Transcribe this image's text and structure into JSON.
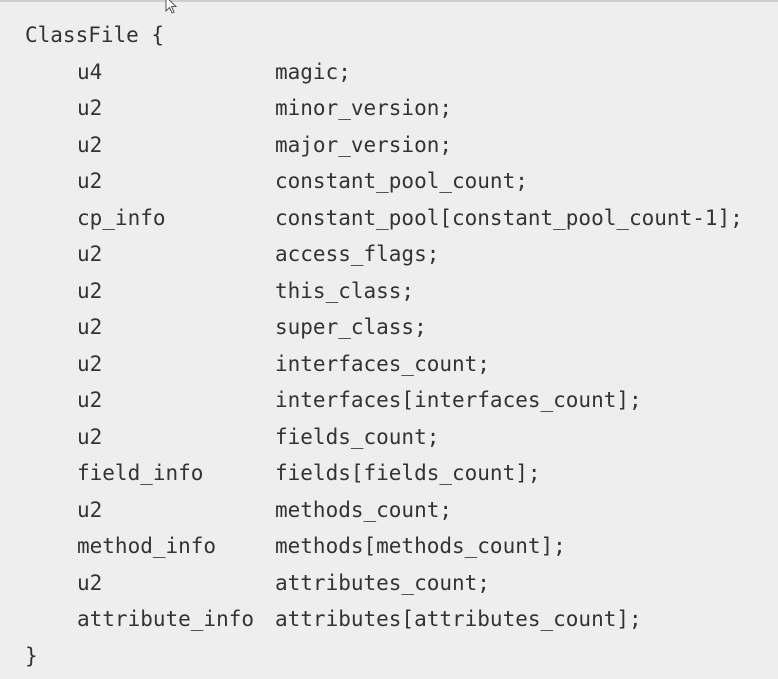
{
  "code": {
    "opening_line": "ClassFile {",
    "closing_line": "}",
    "fields": [
      {
        "type": "u4",
        "name": "magic;"
      },
      {
        "type": "u2",
        "name": "minor_version;"
      },
      {
        "type": "u2",
        "name": "major_version;"
      },
      {
        "type": "u2",
        "name": "constant_pool_count;"
      },
      {
        "type": "cp_info",
        "name": "constant_pool[constant_pool_count-1];"
      },
      {
        "type": "u2",
        "name": "access_flags;"
      },
      {
        "type": "u2",
        "name": "this_class;"
      },
      {
        "type": "u2",
        "name": "super_class;"
      },
      {
        "type": "u2",
        "name": "interfaces_count;"
      },
      {
        "type": "u2",
        "name": "interfaces[interfaces_count];"
      },
      {
        "type": "u2",
        "name": "fields_count;"
      },
      {
        "type": "field_info",
        "name": "fields[fields_count];"
      },
      {
        "type": "u2",
        "name": "methods_count;"
      },
      {
        "type": "method_info",
        "name": "methods[methods_count];"
      },
      {
        "type": "u2",
        "name": "attributes_count;"
      },
      {
        "type": "attribute_info",
        "name": "attributes[attributes_count];"
      }
    ]
  },
  "colors": {
    "background": "#eeeeee",
    "text": "#333333"
  }
}
